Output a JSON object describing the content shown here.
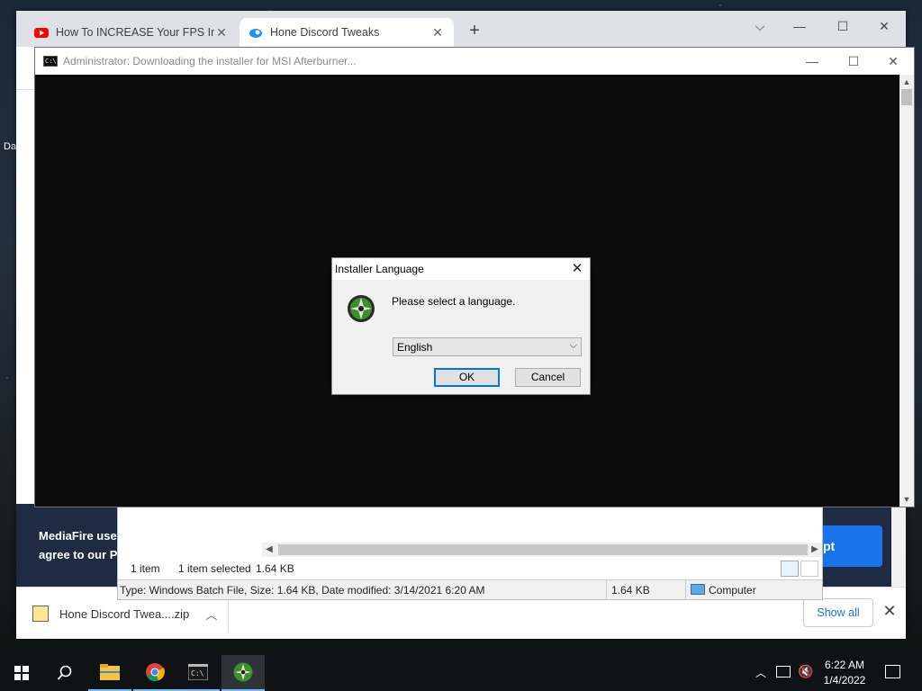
{
  "browser": {
    "tabs": [
      {
        "label": "How To INCREASE Your FPS In M",
        "icon": "youtube-icon",
        "active": false
      },
      {
        "label": "Hone Discord Tweaks",
        "icon": "hone-icon",
        "active": true
      }
    ],
    "new_tab": "+",
    "window_buttons": {
      "dropdown": "⌵",
      "minimize": "—",
      "maximize": "☐",
      "close": "✕"
    }
  },
  "page": {
    "banner_line1": "MediaFire uses",
    "banner_line2": "agree to our Pr",
    "accept_partial": "pt",
    "desktop_fragment": "Da"
  },
  "explorer": {
    "status": {
      "count": "1 item",
      "selected": "1 item selected",
      "size": "1.64 KB"
    },
    "details": {
      "info": "Type: Windows Batch File, Size: 1.64 KB, Date modified: 3/14/2021 6:20 AM",
      "size": "1.64 KB",
      "location": "Computer"
    }
  },
  "cmd": {
    "title": "Administrator:  Downloading the installer for MSI Afterburner...",
    "buttons": {
      "minimize": "—",
      "maximize": "☐",
      "close": "✕"
    }
  },
  "dialog": {
    "title": "Installer Language",
    "close": "✕",
    "prompt": "Please select a language.",
    "language": "English",
    "ok": "OK",
    "cancel": "Cancel"
  },
  "downloads": {
    "file": "Hone Discord Twea....zip",
    "show_all": "Show all",
    "close": "✕"
  },
  "taskbar": {
    "time": "6:22 AM",
    "date": "1/4/2022",
    "apps": [
      "windows-start-icon",
      "search-icon",
      "file-explorer-icon",
      "chrome-icon",
      "cmd-icon",
      "msi-afterburner-icon"
    ]
  },
  "colors": {
    "accent": "#0078d7",
    "link": "#1a73e8",
    "banner": "#1e2b43"
  }
}
